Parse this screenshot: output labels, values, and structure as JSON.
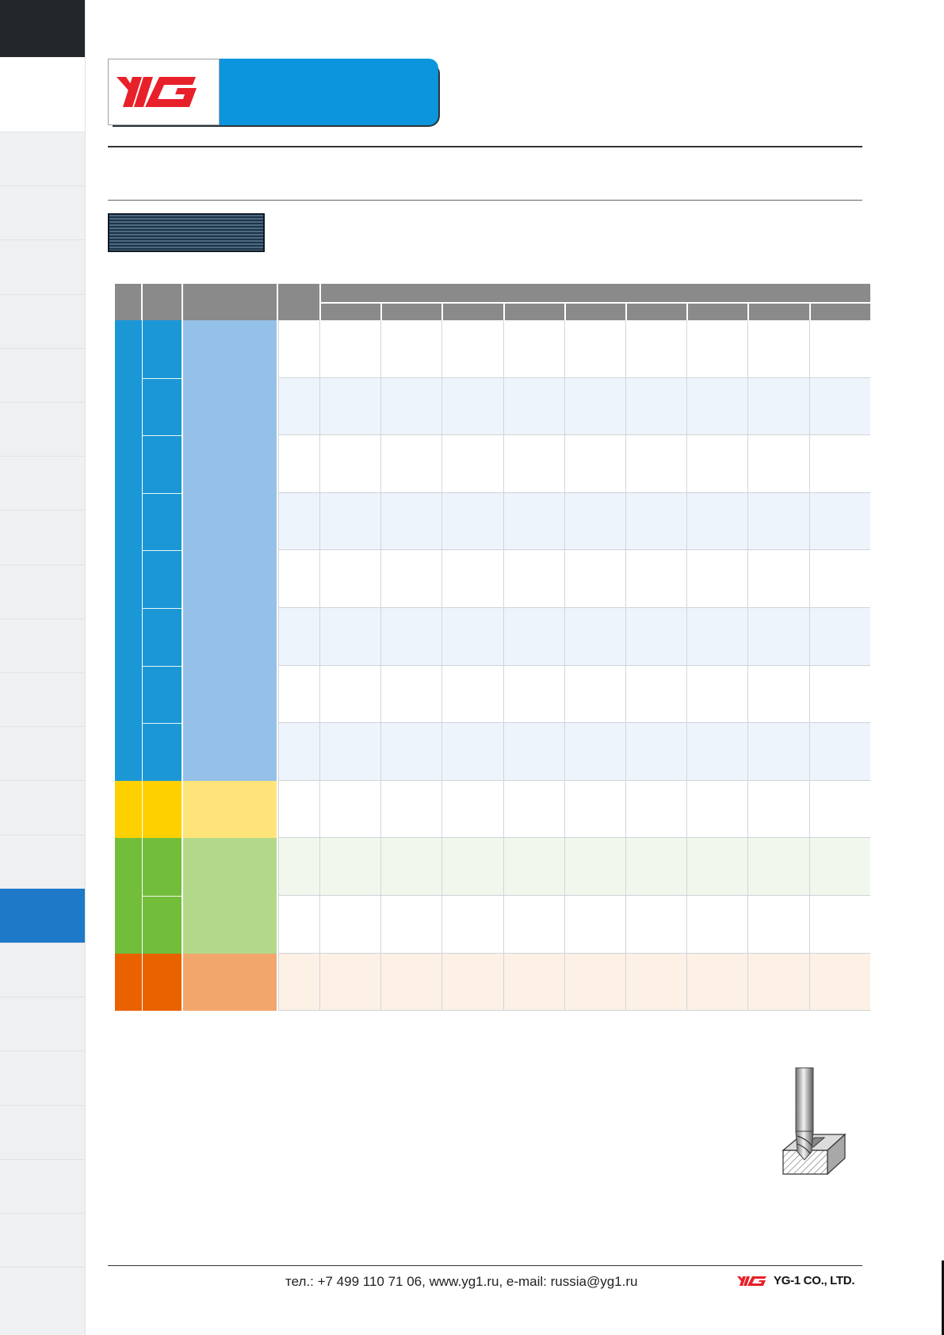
{
  "footer": {
    "contact": "тел.: +7 499 110 71 06, www.yg1.ru, e-mail: russia@yg1.ru",
    "company": "YG-1 CO., LTD."
  },
  "colors": {
    "brand_red": "#e8202a",
    "brand_blue": "#0c95dd",
    "group_p_dark": "#1c97d6",
    "group_p_light": "#95c1e8",
    "group_m_dark": "#ffd000",
    "group_m_light": "#ffe47a",
    "group_k_dark": "#72bd3a",
    "group_k_light": "#b2d98a",
    "group_n_dark": "#ea6100",
    "group_n_light": "#f3a66b"
  },
  "icons": [
    "yg-logo-icon",
    "end-mill-icon",
    "yg-small-logo-icon"
  ]
}
